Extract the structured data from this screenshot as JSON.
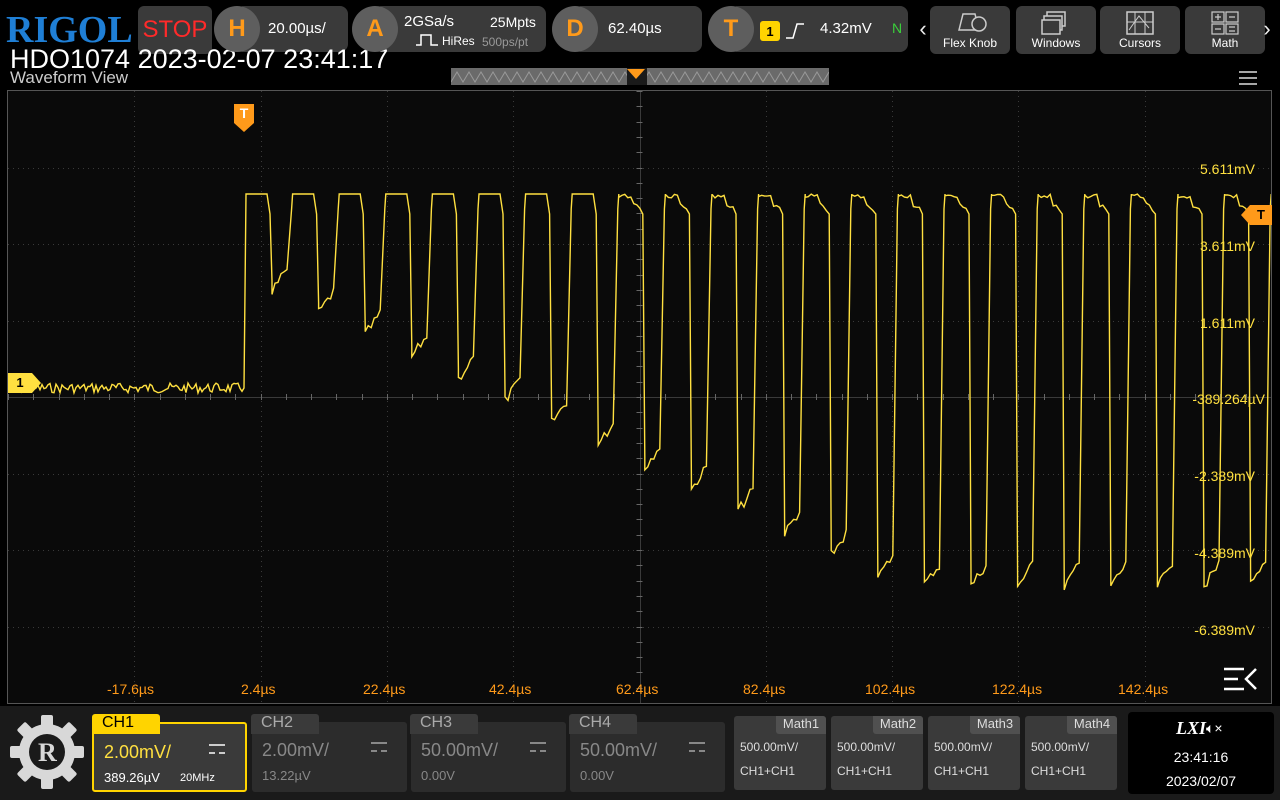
{
  "header": {
    "brand": "RIGOL",
    "run_state": "STOP",
    "horizontal": {
      "icon_letter": "H",
      "scale": "20.00µs/"
    },
    "acquire": {
      "icon_letter": "A",
      "sample_rate": "2GSa/s",
      "memory_depth": "25Mpts",
      "mode": "HiRes",
      "resolution": "500ps/pt"
    },
    "delay": {
      "icon_letter": "D",
      "value": "62.40µs"
    },
    "trigger": {
      "icon_letter": "T",
      "source": "1",
      "level": "4.32mV",
      "mode": "N"
    },
    "tools": [
      {
        "label": "Flex Knob",
        "icon": "flex-knob-icon"
      },
      {
        "label": "Windows",
        "icon": "windows-icon"
      },
      {
        "label": "Cursors",
        "icon": "cursors-icon"
      },
      {
        "label": "Math",
        "icon": "math-icon"
      }
    ]
  },
  "overlay_caption": "HDO1074 2023-02-07 23:41:17",
  "waveform_view": {
    "title": "Waveform View",
    "trigger_marker": "T",
    "channel_marker": "1",
    "trigger_level_marker": "T",
    "y_labels": [
      "5.611mV",
      "3.611mV",
      "1.611mV",
      "-389.264µV",
      "-2.389mV",
      "-4.389mV",
      "-6.389mV"
    ],
    "x_labels": [
      "-17.6µs",
      "2.4µs",
      "22.4µs",
      "42.4µs",
      "62.4µs",
      "82.4µs",
      "102.4µs",
      "122.4µs",
      "142.4µs"
    ],
    "trace_color": "#ffe040",
    "grid_color": "#3a3a3a"
  },
  "channels": [
    {
      "name": "CH1",
      "scale": "2.00mV/",
      "offset": "389.26µV",
      "bandwidth": "20MHz",
      "active": true
    },
    {
      "name": "CH2",
      "scale": "2.00mV/",
      "offset": "13.22µV",
      "bandwidth": "",
      "active": false
    },
    {
      "name": "CH3",
      "scale": "50.00mV/",
      "offset": "0.00V",
      "bandwidth": "",
      "active": false
    },
    {
      "name": "CH4",
      "scale": "50.00mV/",
      "offset": "0.00V",
      "bandwidth": "",
      "active": false
    }
  ],
  "math": [
    {
      "name": "Math1",
      "scale": "500.00mV/",
      "source": "CH1+CH1"
    },
    {
      "name": "Math2",
      "scale": "500.00mV/",
      "source": "CH1+CH1"
    },
    {
      "name": "Math3",
      "scale": "500.00mV/",
      "source": "CH1+CH1"
    },
    {
      "name": "Math4",
      "scale": "500.00mV/",
      "source": "CH1+CH1"
    }
  ],
  "status": {
    "lxi": "LXI",
    "time": "23:41:16",
    "date": "2023/02/07"
  }
}
